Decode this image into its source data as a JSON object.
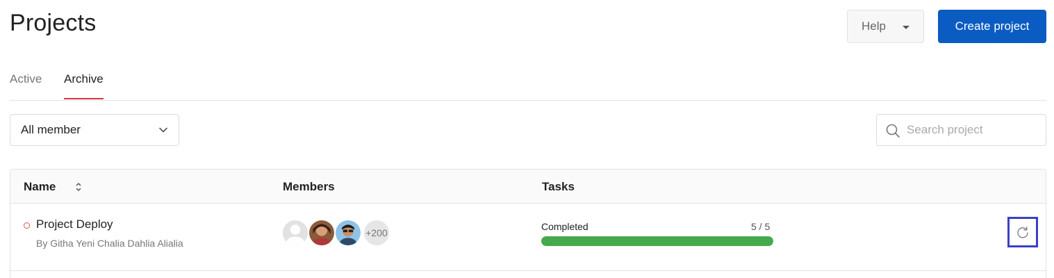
{
  "header": {
    "title": "Projects",
    "help_label": "Help",
    "create_label": "Create project"
  },
  "tabs": [
    {
      "label": "Active",
      "active": false
    },
    {
      "label": "Archive",
      "active": true
    }
  ],
  "filters": {
    "member_select_value": "All member",
    "search_placeholder": "Search project"
  },
  "table": {
    "columns": [
      "Name",
      "Members",
      "Tasks"
    ],
    "rows": [
      {
        "name": "Project Deploy",
        "owner": "By Githa Yeni Chalia Dahlia Alialia",
        "status_color": "#d9534f",
        "members_more": "+200",
        "task_status": "Completed",
        "task_count": "5 / 5",
        "progress": 1.0,
        "action_icon": "restore-icon"
      }
    ]
  },
  "colors": {
    "accent": "#0a5cc2",
    "tab_underline": "#d63344",
    "progress": "#44aa4c",
    "focus_outline": "#3b3fc7"
  }
}
